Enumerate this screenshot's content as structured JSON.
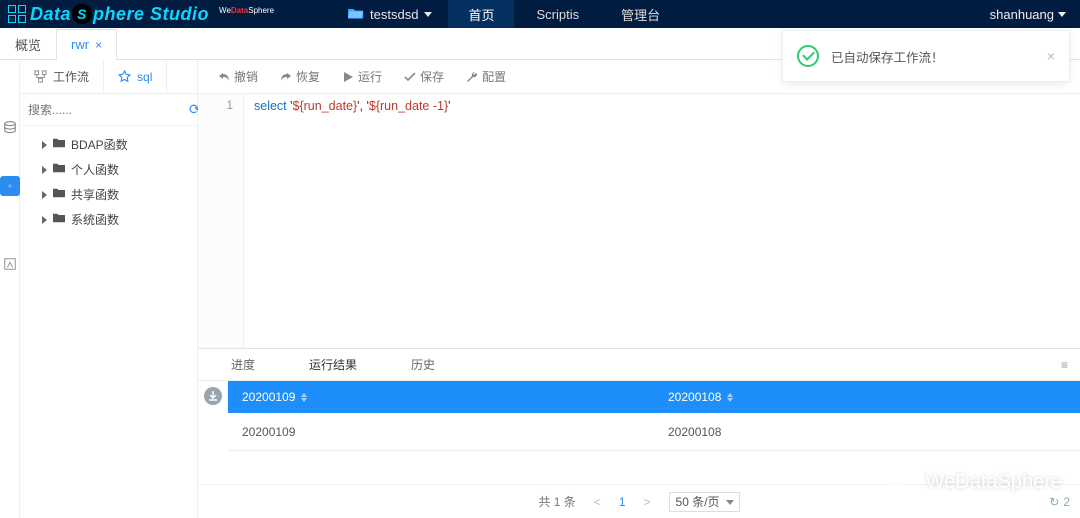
{
  "brand": {
    "name_html": "DataSphere Studio",
    "sub_pre": "We",
    "sub_mid": "Data",
    "sub_post": "Sphere"
  },
  "top": {
    "project_name": "testsdsd",
    "menu": [
      "首页",
      "Scriptis",
      "管理台"
    ],
    "active_menu_index": 0,
    "user": "shanhuang"
  },
  "tabs": [
    {
      "label": "概览",
      "closable": false,
      "active": false
    },
    {
      "label": "rwr",
      "closable": true,
      "active": true
    }
  ],
  "subtabs": [
    {
      "label": "工作流",
      "icon": "flow",
      "active": false
    },
    {
      "label": "sql",
      "icon": "star",
      "active": true
    }
  ],
  "search": {
    "placeholder": "搜索......"
  },
  "tree": [
    {
      "label": "BDAP函数"
    },
    {
      "label": "个人函数"
    },
    {
      "label": "共享函数"
    },
    {
      "label": "系统函数"
    }
  ],
  "toolbar": {
    "undo": "撤销",
    "redo": "恢复",
    "run": "运行",
    "save": "保存",
    "config": "配置"
  },
  "editor": {
    "line_no": "1",
    "code_kw": "select",
    "code_rest_1": " '",
    "code_var_1": "${run_date}",
    "code_rest_2": "', '",
    "code_var_2": "${run_date -1}",
    "code_rest_3": "'"
  },
  "result_tabs": [
    "进度",
    "运行结果",
    "历史"
  ],
  "result_active_index": 1,
  "result_table": {
    "columns": [
      "20200109",
      "20200108"
    ],
    "rows": [
      [
        "20200109",
        "20200108"
      ]
    ]
  },
  "pager": {
    "total_label": "共 1 条",
    "page": "1",
    "size_label": "50 条/页",
    "reload_count": "2"
  },
  "toast": {
    "message": "已自动保存工作流！"
  },
  "watermark": "WeDataSphere"
}
